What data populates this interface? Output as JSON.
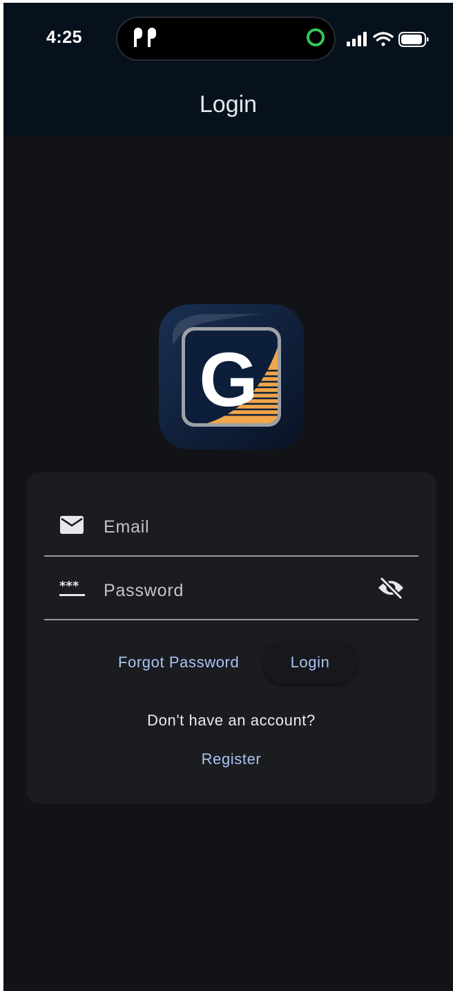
{
  "status_bar": {
    "time": "4:25",
    "icons": [
      "airpods-icon",
      "activity-ring-icon",
      "cellular-signal-icon",
      "wifi-icon",
      "battery-icon"
    ],
    "ring_color": "#34c759"
  },
  "app_bar": {
    "title": "Login"
  },
  "logo": {
    "name": "app-logo",
    "letter": "G",
    "accent_color": "#f0a64a",
    "bg_color": "#0c1e3a"
  },
  "form": {
    "email": {
      "placeholder": "Email",
      "value": "",
      "icon": "mail-icon"
    },
    "password": {
      "placeholder": "Password",
      "value": "",
      "icon": "password-icon",
      "toggle_icon": "eye-off-icon"
    }
  },
  "actions": {
    "forgot_password": "Forgot Password",
    "login": "Login",
    "no_account": "Don't have an account?",
    "register": "Register"
  },
  "colors": {
    "background": "#121317",
    "app_bar": "#07111d",
    "card": "#1b1c20",
    "link": "#a9c4f2"
  }
}
